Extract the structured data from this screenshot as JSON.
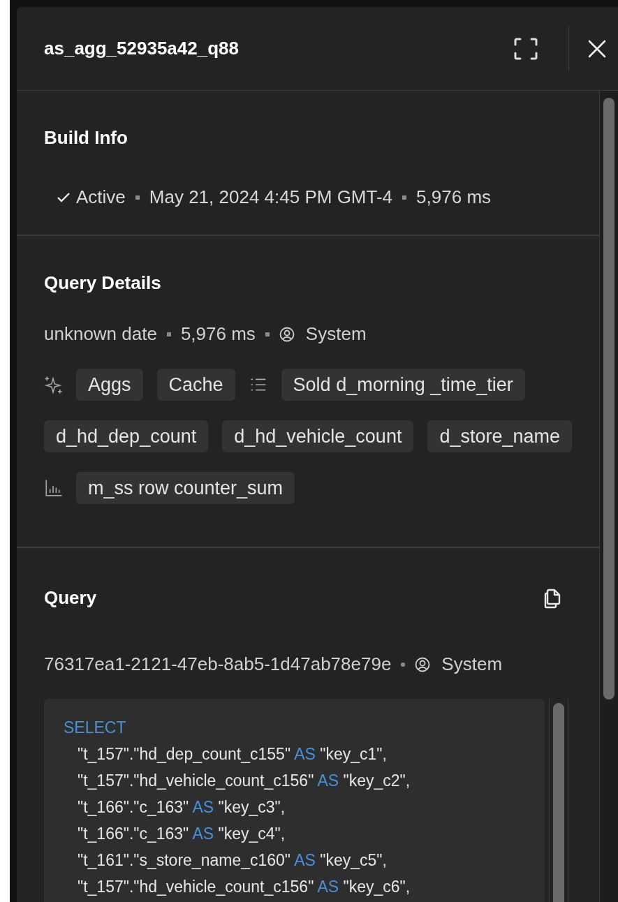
{
  "header": {
    "title": "as_agg_52935a42_q88"
  },
  "build_info": {
    "title": "Build Info",
    "status": "Active",
    "active": true,
    "date": "May 21, 2024 4:45 PM GMT-4",
    "duration": "5,976 ms"
  },
  "query_details": {
    "title": "Query Details",
    "date": "unknown date",
    "duration": "5,976 ms",
    "user": "System",
    "items": [
      {
        "kind": "sparkle"
      },
      {
        "kind": "chip",
        "label": "Aggs"
      },
      {
        "kind": "chip",
        "label": "Cache"
      },
      {
        "kind": "list"
      },
      {
        "kind": "chip",
        "label": "Sold d_morning _time_tier"
      },
      {
        "kind": "chip",
        "label": "d_hd_dep_count"
      },
      {
        "kind": "chip",
        "label": "d_hd_vehicle_count"
      },
      {
        "kind": "chip",
        "label": "d_store_name"
      },
      {
        "kind": "chart"
      },
      {
        "kind": "chip",
        "label": "m_ss row counter_sum"
      }
    ]
  },
  "query": {
    "title": "Query",
    "id": "76317ea1-2121-47eb-8ab5-1d47ab78e79e",
    "user": "System",
    "lines": [
      {
        "indent": false,
        "parts": [
          {
            "kind": "keyword",
            "text": "SELECT"
          }
        ]
      },
      {
        "indent": true,
        "parts": [
          {
            "kind": "text",
            "text": "\"t_157\".\"hd_dep_count_c155\""
          },
          {
            "kind": "keyword",
            "text": "AS"
          },
          {
            "kind": "text",
            "text": "\"key_c1\","
          }
        ]
      },
      {
        "indent": true,
        "parts": [
          {
            "kind": "text",
            "text": "\"t_157\".\"hd_vehicle_count_c156\""
          },
          {
            "kind": "keyword",
            "text": "AS"
          },
          {
            "kind": "text",
            "text": "\"key_c2\","
          }
        ]
      },
      {
        "indent": true,
        "parts": [
          {
            "kind": "text",
            "text": "\"t_166\".\"c_163\""
          },
          {
            "kind": "keyword",
            "text": "AS"
          },
          {
            "kind": "text",
            "text": "\"key_c3\","
          }
        ]
      },
      {
        "indent": true,
        "parts": [
          {
            "kind": "text",
            "text": "\"t_166\".\"c_163\""
          },
          {
            "kind": "keyword",
            "text": "AS"
          },
          {
            "kind": "text",
            "text": "\"key_c4\","
          }
        ]
      },
      {
        "indent": true,
        "parts": [
          {
            "kind": "text",
            "text": "\"t_161\".\"s_store_name_c160\""
          },
          {
            "kind": "keyword",
            "text": "AS"
          },
          {
            "kind": "text",
            "text": "\"key_c5\","
          }
        ]
      },
      {
        "indent": true,
        "parts": [
          {
            "kind": "text",
            "text": "\"t_157\".\"hd_vehicle_count_c156\""
          },
          {
            "kind": "keyword",
            "text": "AS"
          },
          {
            "kind": "text",
            "text": "\"key_c6\","
          }
        ]
      }
    ]
  }
}
